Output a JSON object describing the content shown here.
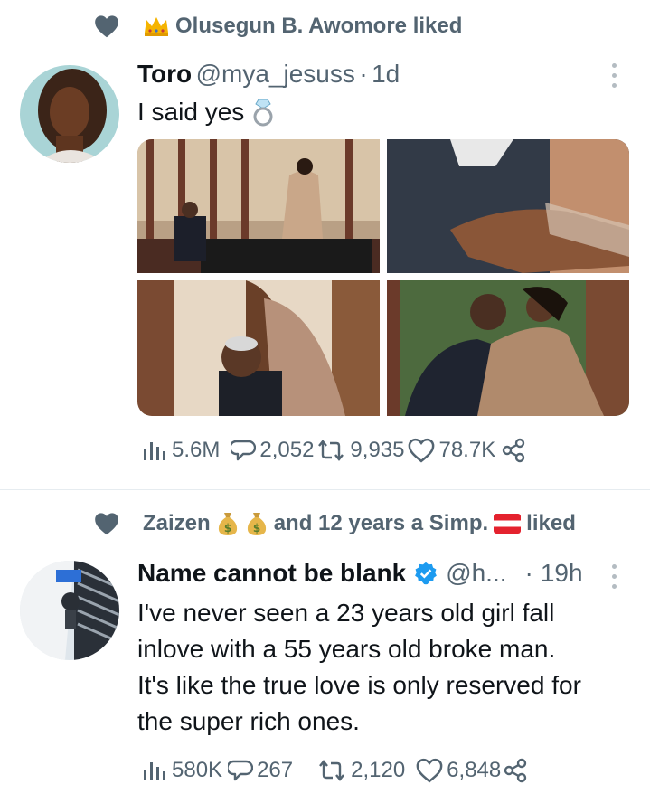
{
  "tweet1": {
    "social_context": "Olusegun B. Awomore liked",
    "name": "Toro",
    "handle": "@mya_jesuss",
    "sep": "·",
    "time": "1d",
    "text": "I said yes",
    "stats": {
      "views": "5.6M",
      "replies": "2,052",
      "retweets": "9,935",
      "likes": "78.7K"
    }
  },
  "tweet2": {
    "social_name": "Zaizen",
    "social_rest": "and 12 years a Simp.",
    "social_suffix": "liked",
    "name": "Name cannot be blank",
    "handle": "@h...",
    "sep": "·",
    "time": "19h",
    "text_lines": [
      "I've never seen a 23 years old girl fall",
      "inlove with a 55 years old broke man.",
      "It's like the true love is only reserved for",
      "the super rich ones."
    ],
    "stats": {
      "views": "580K",
      "replies": "267",
      "retweets": "2,120",
      "likes": "6,848"
    }
  },
  "colors": {
    "text": "#0f1419",
    "secondary": "#536471",
    "verified": "#1d9bf0",
    "divider": "#e6ecf0"
  },
  "icons": [
    "heart-icon",
    "crown-icon",
    "ring-icon",
    "money-bag-icon",
    "austria-flag-icon",
    "verified-badge-icon",
    "views-icon",
    "reply-icon",
    "retweet-icon",
    "like-icon",
    "share-icon",
    "more-icon"
  ]
}
